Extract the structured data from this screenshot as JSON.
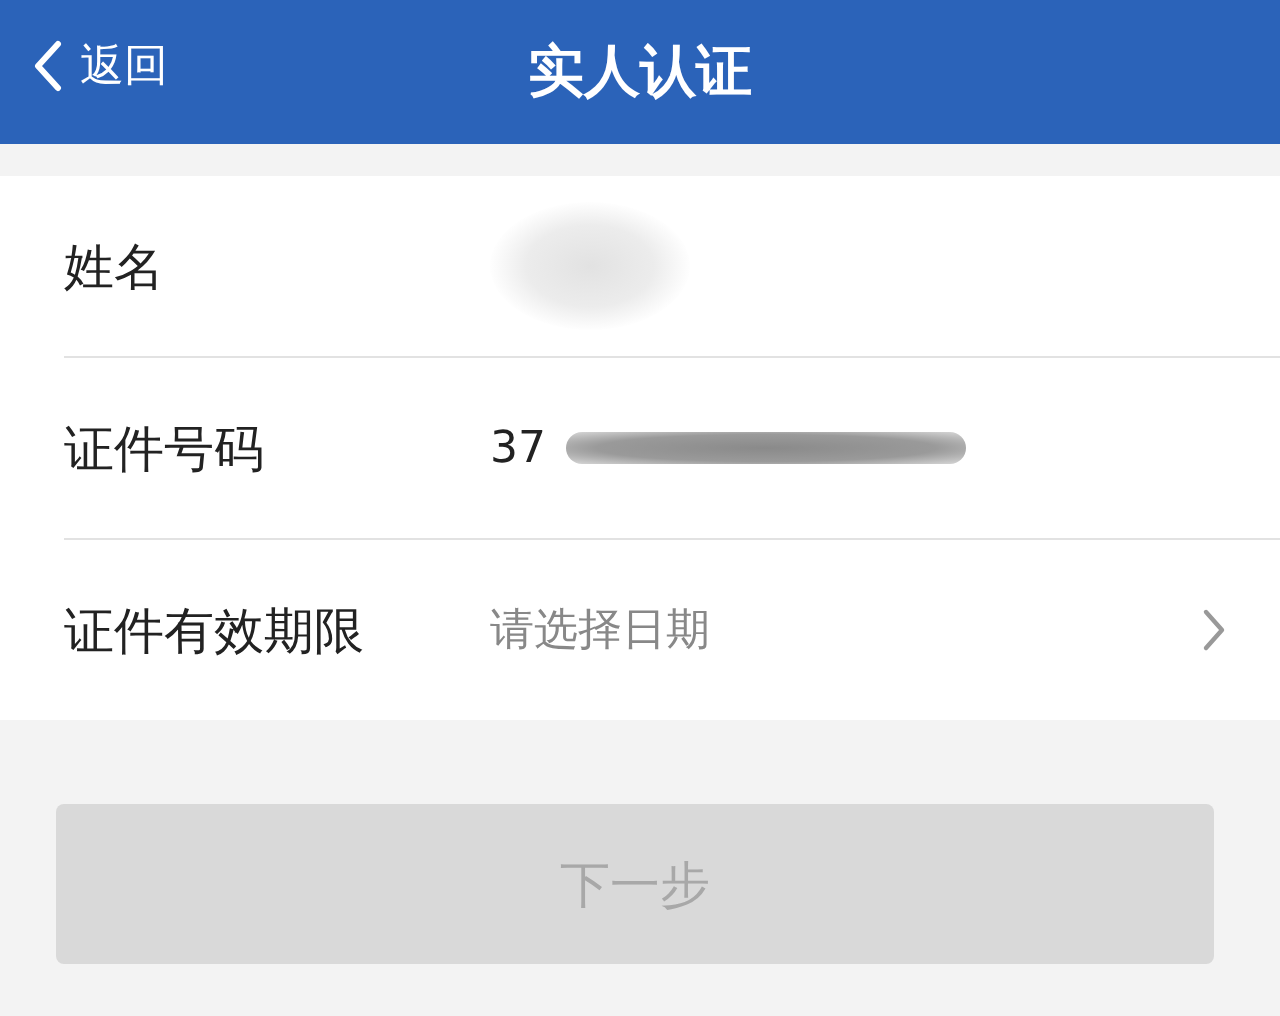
{
  "nav_bar": {
    "back": "返回",
    "title": "实人认证"
  },
  "form_rows": [
    {
      "kind": "input",
      "label": "姓名",
      "value": "",
      "redacted": true
    },
    {
      "kind": "input",
      "label": "证件号码",
      "value": "37",
      "redacted": true
    },
    {
      "kind": "picker",
      "label": "证件有效期限",
      "placeholder": "请选择日期"
    }
  ],
  "next_button": {
    "label": "下一步",
    "disabled": true
  }
}
